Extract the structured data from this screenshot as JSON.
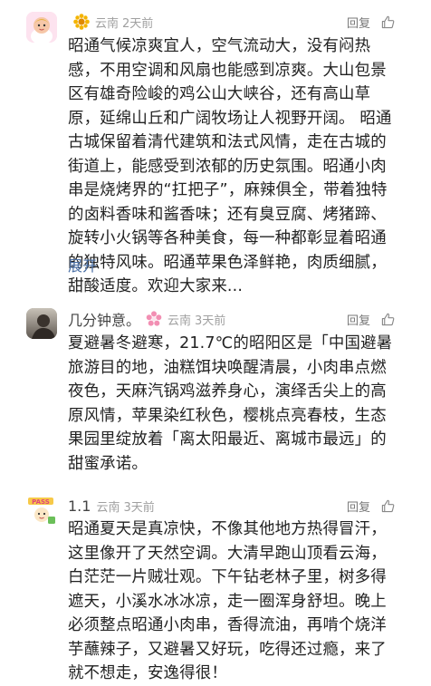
{
  "comments": [
    {
      "username": "",
      "badge_icon": "sunflower-badge-icon",
      "region": "云南",
      "time": "2天前",
      "reply_label": "回复",
      "text": "昭通气候凉爽宜人，空气流动大，没有闷热感，不用空调和风扇也能感到凉爽。大山包景区有雄奇险峻的鸡公山大峡谷，还有高山草原，延绵山丘和广阔牧场让人视野开阔。 昭通古城保留着清代建筑和法式风情，走在古城的街道上，能感受到浓郁的历史氛围。昭通小肉串是烧烤界的“扛把子”，麻辣俱全，带着独特的卤料香味和酱香味；还有臭豆腐、烤猪蹄、旋转小火锅等各种美食，每一种都彰显着昭通的独特风味。昭通苹果色泽鲜艳，肉质细腻，甜酸适度。欢迎大家来...",
      "expand_label": "展开"
    },
    {
      "username": "几分钟意。",
      "badge_icon": "pink-flower-badge-icon",
      "region": "云南",
      "time": "3天前",
      "reply_label": "回复",
      "text": "夏避暑冬避寒，21.7℃的昭阳区是「中国避暑旅游目的地，油糕饵块唤醒清晨，小肉串点燃夜色，天麻汽锅鸡滋养身心，演绎舌尖上的高原风情，苹果染红秋色，樱桃点亮春枝，生态果园里绽放着「离太阳最近、离城市最远」的甜蜜承诺。"
    },
    {
      "username": "1.1",
      "badge_icon": "",
      "region": "云南",
      "time": "3天前",
      "reply_label": "回复",
      "text": "昭通夏天是真凉快，不像其他地方热得冒汗，这里像开了天然空调。大清早跑山顶看云海，白茫茫一片贼壮观。下午钻老林子里，树多得遮天，小溪水冰冰凉，走一圈浑身舒坦。晚上必须整点昭通小肉串，香得流油，再啃个烧洋芋蘸辣子，又避暑又好玩，吃得还过瘾，来了就不想走，安逸得很！"
    }
  ]
}
